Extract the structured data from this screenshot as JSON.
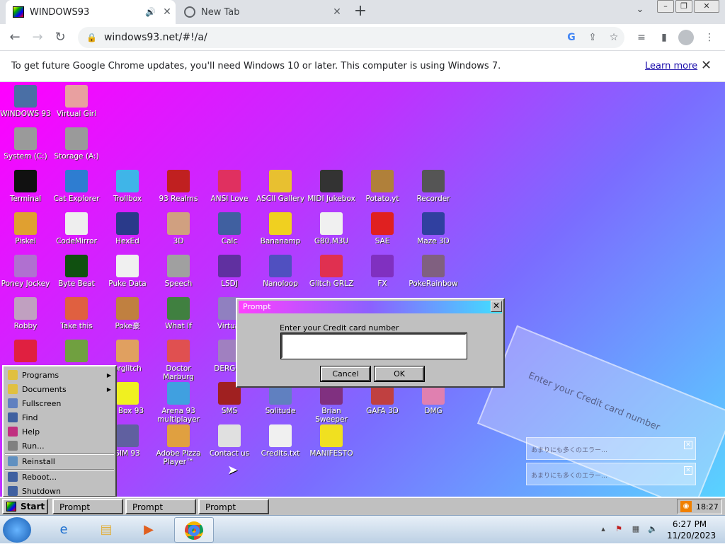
{
  "browser": {
    "tabs": [
      {
        "title": "WINDOWS93",
        "icon": "windows93-favicon"
      },
      {
        "title": "New Tab",
        "icon": "chrome-globe-icon"
      }
    ],
    "url": "windows93.net/#!/a/",
    "infobar": {
      "message": "To get future Google Chrome updates, you'll need Windows 10 or later. This computer is using Windows 7.",
      "link": "Learn more"
    }
  },
  "desktop": {
    "icons": [
      {
        "label": "WINDOWS 93",
        "icon": "computer-icon",
        "color": "#4a6fa5"
      },
      {
        "label": "Virtual Girl",
        "icon": "face-icon",
        "color": "#e8a0a0"
      },
      {
        "label": "System (C:)",
        "icon": "drive-icon",
        "color": "#9a9a9a"
      },
      {
        "label": "Storage (A:)",
        "icon": "floppy-icon",
        "color": "#9a9a9a"
      },
      {
        "label": "Terminal",
        "icon": "terminal-icon",
        "color": "#111111"
      },
      {
        "label": "Cat Explorer",
        "icon": "globe-icon",
        "color": "#2e7dd1"
      },
      {
        "label": "Trollbox",
        "icon": "chat-icon",
        "color": "#3fb5e8"
      },
      {
        "label": "93 Realms",
        "icon": "knight-icon",
        "color": "#c02020"
      },
      {
        "label": "ANSI Love",
        "icon": "letter-a-icon",
        "color": "#e03060"
      },
      {
        "label": "ASCII Gallery",
        "icon": "numbers-icon",
        "color": "#e8c030"
      },
      {
        "label": "MIDI Jukebox",
        "icon": "piano-icon",
        "color": "#333333"
      },
      {
        "label": "Potato.yt",
        "icon": "potato-icon",
        "color": "#b0803a"
      },
      {
        "label": "Recorder",
        "icon": "microphone-icon",
        "color": "#555555"
      },
      {
        "label": "Piskel",
        "icon": "palette-icon",
        "color": "#e0a030"
      },
      {
        "label": "CodeMirror",
        "icon": "cat-code-icon",
        "color": "#eeeeee"
      },
      {
        "label": "HexEd",
        "icon": "hex-icon",
        "color": "#2a3a8a"
      },
      {
        "label": "3D",
        "icon": "teapot-icon",
        "color": "#d0a080"
      },
      {
        "label": "Calc",
        "icon": "calculator-icon",
        "color": "#4060a0"
      },
      {
        "label": "Bananamp",
        "icon": "banana-icon",
        "color": "#f0d020"
      },
      {
        "label": "G80.M3U",
        "icon": "speaker-file-icon",
        "color": "#f0f0f0"
      },
      {
        "label": "SAE",
        "icon": "amiga-ball-icon",
        "color": "#e02020"
      },
      {
        "label": "Maze 3D",
        "icon": "maze-icon",
        "color": "#3040a0"
      },
      {
        "label": "Poney Jockey",
        "icon": "pony-icon",
        "color": "#b070d0"
      },
      {
        "label": "Byte Beat",
        "icon": "bytebeat-icon",
        "color": "#105010"
      },
      {
        "label": "Puke Data",
        "icon": "pd-icon",
        "color": "#f0f0f0"
      },
      {
        "label": "Speech",
        "icon": "speech-face-icon",
        "color": "#a0a0a0"
      },
      {
        "label": "LSDJ",
        "icon": "lsdj-icon",
        "color": "#6030a0"
      },
      {
        "label": "Nanoloop",
        "icon": "wave-icon",
        "color": "#5050c0"
      },
      {
        "label": "Glitch GRLZ",
        "icon": "lips-icon",
        "color": "#e03050"
      },
      {
        "label": "FX",
        "icon": "atom-icon",
        "color": "#8030c0"
      },
      {
        "label": "PokeRainbow",
        "icon": "pixel-people-icon",
        "color": "#806080"
      },
      {
        "label": "Robby",
        "icon": "stick-figure-icon",
        "color": "#c0a0c0"
      },
      {
        "label": "Take this",
        "icon": "bearded-man-icon",
        "color": "#e06040"
      },
      {
        "label": "Poke豪",
        "icon": "pokeball-icon",
        "color": "#c08040"
      },
      {
        "label": "What If",
        "icon": "grid-icon",
        "color": "#408040"
      },
      {
        "label": "Virtual",
        "icon": "window-icon",
        "color": "#9080c0"
      },
      {
        "label": "",
        "icon": "red-app-icon",
        "color": "#e02040"
      },
      {
        "label": "",
        "icon": "yoda-icon",
        "color": "#70a040"
      },
      {
        "label": "orglitch",
        "icon": "corgi-icon",
        "color": "#e0a060"
      },
      {
        "label": "Doctor Marburg",
        "icon": "doctor-icon",
        "color": "#e05050"
      },
      {
        "label": "DERG32",
        "icon": "robot-icon",
        "color": "#a080c0"
      },
      {
        "label": "d Box 93",
        "icon": "smiley-icon",
        "color": "#f0f020"
      },
      {
        "label": "Arena 93 multiplayer",
        "icon": "cube-icon",
        "color": "#40a0e0"
      },
      {
        "label": "SMS",
        "icon": "sms-icon",
        "color": "#a02020"
      },
      {
        "label": "Solitude",
        "icon": "bottle-icon",
        "color": "#6080c0"
      },
      {
        "label": "Brian Sweeper",
        "icon": "mine-icon",
        "color": "#803080"
      },
      {
        "label": "GAFA 3D",
        "icon": "man-face-icon",
        "color": "#c04040"
      },
      {
        "label": "DMG",
        "icon": "dmg-icon",
        "color": "#e080b0"
      },
      {
        "label": "SIM 93",
        "icon": "sim-icon",
        "color": "#6060a0"
      },
      {
        "label": "Adobe Pizza Player™",
        "icon": "pizza-icon",
        "color": "#e0a040"
      },
      {
        "label": "Contact us",
        "icon": "contact-icon",
        "color": "#e0e0e0"
      },
      {
        "label": "Credits.txt",
        "icon": "text-file-icon",
        "color": "#f0f0f0"
      },
      {
        "label": "MANIFESTO",
        "icon": "question-icon",
        "color": "#f0e020"
      }
    ],
    "ghost_dialog_text": "Enter your Credit card number",
    "ghost_toasts": [
      "あまりにも多くのエラー…",
      "あまりにも多くのエラー…"
    ]
  },
  "prompt": {
    "title": "Prompt",
    "label": "Enter your Credit card number",
    "value": "",
    "cancel": "Cancel",
    "ok": "OK"
  },
  "start_menu": {
    "items": [
      {
        "label": "Programs",
        "submenu": true,
        "icon": "programs-icon"
      },
      {
        "label": "Documents",
        "submenu": true,
        "icon": "documents-icon"
      },
      {
        "label": "Fullscreen",
        "submenu": false,
        "icon": "fullscreen-icon"
      },
      {
        "label": "Find",
        "submenu": false,
        "icon": "find-icon"
      },
      {
        "label": "Help",
        "submenu": false,
        "icon": "help-icon"
      },
      {
        "label": "Run...",
        "submenu": false,
        "icon": "run-icon"
      },
      {
        "label": "Reinstall",
        "submenu": false,
        "icon": "reinstall-icon"
      },
      {
        "label": "Reboot...",
        "submenu": false,
        "icon": "reboot-icon"
      },
      {
        "label": "Shutdown",
        "submenu": false,
        "icon": "shutdown-icon"
      }
    ]
  },
  "w93_taskbar": {
    "start_label": "Start",
    "tasks": [
      "Prompt",
      "Prompt",
      "Prompt"
    ],
    "clock": "18:27"
  },
  "w7_taskbar": {
    "time": "6:27 PM",
    "date": "11/20/2023",
    "apps": [
      "ie-icon",
      "explorer-icon",
      "media-player-icon",
      "chrome-icon"
    ]
  }
}
